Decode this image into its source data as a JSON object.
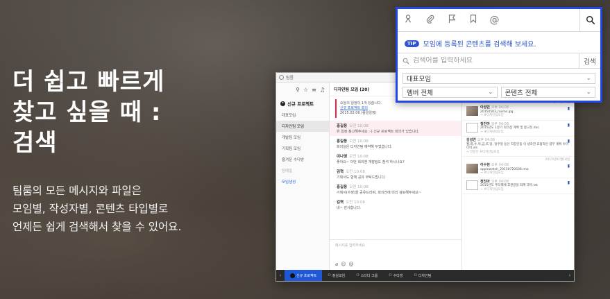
{
  "hero": {
    "title_line1": "더 쉽고 빠르게",
    "title_line2": "찾고 싶을 때 :",
    "title_line3": "검색",
    "desc_line1": "팀룸의 모든 메시지와 파일은",
    "desc_line2": "모임별, 작성자별, 콘텐츠 타입별로",
    "desc_line3": "언제든 쉽게 검색해서 찾을 수 있어요."
  },
  "search_popup": {
    "tip_badge": "TIP",
    "tip_text": "모임에 등록된 콘텐츠를 검색해 보세요.",
    "placeholder": "검색어를 입력하세요",
    "go_label": "검색",
    "group_select": "대표모임",
    "member_select": "멤버 전체",
    "content_select": "콘텐츠 전체",
    "tools": [
      "mention-author-icon",
      "clip-icon",
      "flag-icon",
      "bookmark-icon",
      "at-icon"
    ]
  },
  "app": {
    "title": "팀룸",
    "sidebar": {
      "project_title": "신규 프로젝트",
      "items": [
        {
          "label": "대표모임"
        },
        {
          "label": "디자인팀 모임"
        },
        {
          "label": "개발팀 모임"
        },
        {
          "label": "기획팀 모임"
        },
        {
          "label": "즐겨운 수다방"
        },
        {
          "label": "팀메일"
        },
        {
          "label": "모임생성"
        }
      ]
    },
    "chat": {
      "header": "디자인팀 모임 (20)",
      "notice_line1": "오늘의 일정이 1개 있습니다.",
      "notice_link1": "신규 프로젝트 회의",
      "notice_line2": "2015.02.06 (종일일정)",
      "messages": [
        {
          "name": "홍길동",
          "time": "오전 10:08",
          "text": "위 일정 참고해주세요 :-) 신규 프로젝트 회의가 있습니다."
        },
        {
          "name": "홍길동",
          "time": "오전 10:08",
          "text": "회의실은 디자인팀 예약해 두었습니다."
        },
        {
          "name": "이나영",
          "time": "오전 10:08",
          "text": "좋아요~ 이번 회의엔 개발팀도 참석 하시나요?"
        },
        {
          "name": "김혁",
          "time": "오전 10:08",
          "text": "기획서도 함께 공유 부탁드립니다."
        },
        {
          "name": "홍길동",
          "time": "오전 10:08",
          "text": "기획서(수정)을 공유드리며, 회의전에 미리 검토해주세요~"
        },
        {
          "name": "김혁",
          "time": "오전 10:08",
          "text": "네~ 감사합니다."
        }
      ],
      "composer_placeholder": "메시지를 입력하세요"
    },
    "results": {
      "filter_group": "디자인팀모임",
      "filter_author": "작성자전체",
      "filter_type": "첨부파일",
      "date1": "2015년01월23일",
      "date2": "2015년01월18일",
      "items": [
        {
          "name": "이성민",
          "time": "오후 04:08",
          "text": "20150503_rooms.jpg",
          "meta": "→ #디자인팀모임"
        },
        {
          "name": "정진아",
          "time": "오후 04:08",
          "text": "2015년도 1분기 워크샵 계획 및 항구문.doc",
          "meta": "→ #디자인팀모임"
        },
        {
          "name": "김성연",
          "time": "오후 04:08",
          "text": "월,화,수,목,금,토,일, 일주일 동안 직장인들 이 생각한 효율적인 업무 계획 아이디어.xls",
          "meta": "→ 반갈인 #디자인팀모임"
        },
        {
          "name": "이수현",
          "time": "오후 04:08",
          "text": "applewatch_20150720506.ima",
          "meta": "→ #디자인팀모임"
        },
        {
          "name": "정진아",
          "time": "오후 04:08",
          "text": "2015년도 푸터팩에 후원받을 화께 과목.txt",
          "meta": "→ #디자인팀모임"
        }
      ]
    },
    "bottombar": {
      "tabs": [
        "신규 프로젝트",
        "정심모임",
        "스터디 그룹",
        "수다방",
        "디자인팀"
      ]
    }
  },
  "colors": {
    "accent": "#2346e8",
    "tip_blue": "#2a52c6",
    "bottom_active": "#1f57d6"
  }
}
